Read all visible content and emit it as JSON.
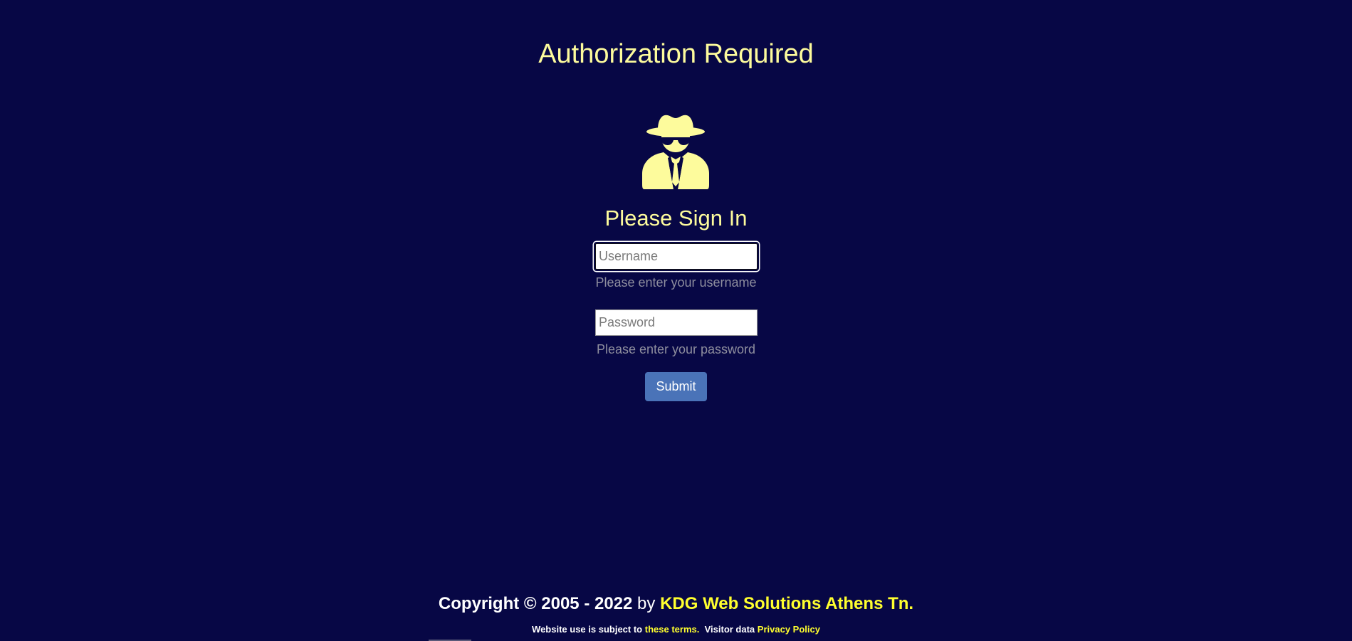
{
  "page": {
    "title": "Authorization Required",
    "subtitle": "Please Sign In"
  },
  "form": {
    "username": {
      "value": "",
      "placeholder": "Username",
      "hint": "Please enter your username"
    },
    "password": {
      "value": "",
      "placeholder": "Password",
      "hint": "Please enter your password"
    },
    "submit_label": "Submit"
  },
  "footer": {
    "copyright": "Copyright © 2005 - 2022",
    "by": "by",
    "company": "KDG Web Solutions Athens Tn.",
    "terms_prefix": "Website use is subject to",
    "terms_link": "these terms.",
    "visitor_data": "Visitor data",
    "privacy_link": "Privacy Policy"
  },
  "icons": {
    "hero": "spy-icon"
  },
  "colors": {
    "background": "#070745",
    "accent_yellow": "#fdfb9c",
    "link_yellow": "#ffff2e",
    "button_blue": "#4a73b8",
    "hint_gray": "#8e8e9e"
  }
}
